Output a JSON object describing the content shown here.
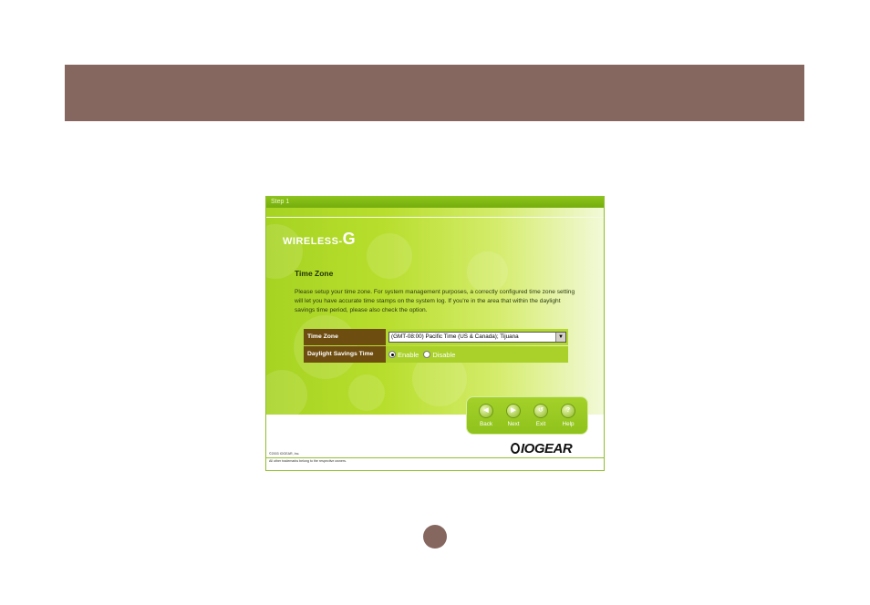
{
  "wizard": {
    "step_label": "Step 1",
    "logo_text": "WIRELESS-",
    "logo_g": "G",
    "section_title": "Time Zone",
    "description": "Please setup your time zone. For system management purposes, a correctly configured time zone setting will let you have accurate time stamps on the system log. If you're in the area that within the daylight savings time period, please also check the option.",
    "settings": {
      "time_zone_label": "Time Zone",
      "time_zone_value": "(GMT-08:00) Pacific Time (US & Canada); Tijuana",
      "dst_label": "Daylight Savings Time",
      "dst_enable": "Enable",
      "dst_disable": "Disable",
      "dst_selected": "Enable"
    },
    "nav": {
      "back": "Back",
      "next": "Next",
      "exit": "Exit",
      "help": "Help"
    },
    "copyright": "©2003 IOGEAR, Inc.",
    "trademarks": "All other trademarks belong to the respective owners.",
    "brand": "IOGEAR"
  },
  "colors": {
    "header_bar": "#856760",
    "wizard_green": "#a6d322",
    "settings_label_bg": "#6e4d11"
  }
}
